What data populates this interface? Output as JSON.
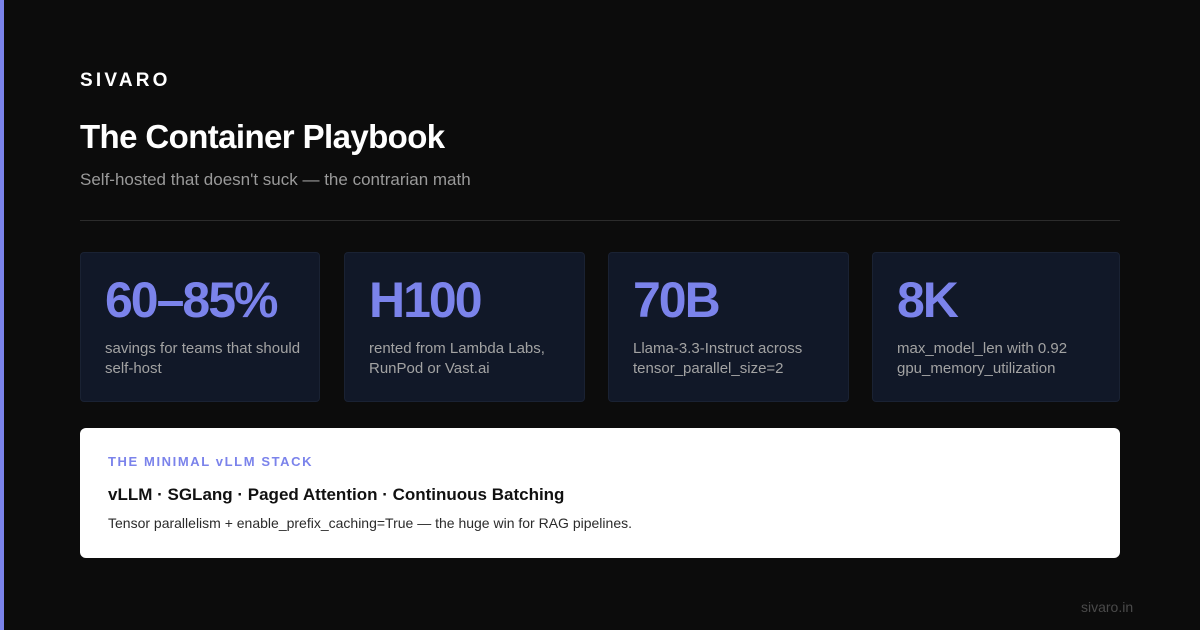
{
  "brand": "SIVARO",
  "title": "The Container Playbook",
  "subtitle": "Self-hosted that doesn't suck — the contrarian math",
  "stats": [
    {
      "value": "60–85%",
      "description": "savings for teams that should self-host"
    },
    {
      "value": "H100",
      "description": "rented from Lambda Labs, RunPod or Vast.ai"
    },
    {
      "value": "70B",
      "description": "Llama-3.3-Instruct across tensor_parallel_size=2"
    },
    {
      "value": "8K",
      "description": "max_model_len with 0.92 gpu_memory_utilization"
    }
  ],
  "stack": {
    "eyebrow": "THE MINIMAL vLLM STACK",
    "headline": "vLLM · SGLang · Paged Attention · Continuous Batching",
    "body": "Tensor parallelism + enable_prefix_caching=True — the huge win for RAG pipelines."
  },
  "footer": {
    "url": "sivaro.in"
  },
  "colors": {
    "background": "#0c0c0c",
    "accent": "#7b83eb",
    "card_background": "#111828",
    "panel_background": "#ffffff"
  }
}
